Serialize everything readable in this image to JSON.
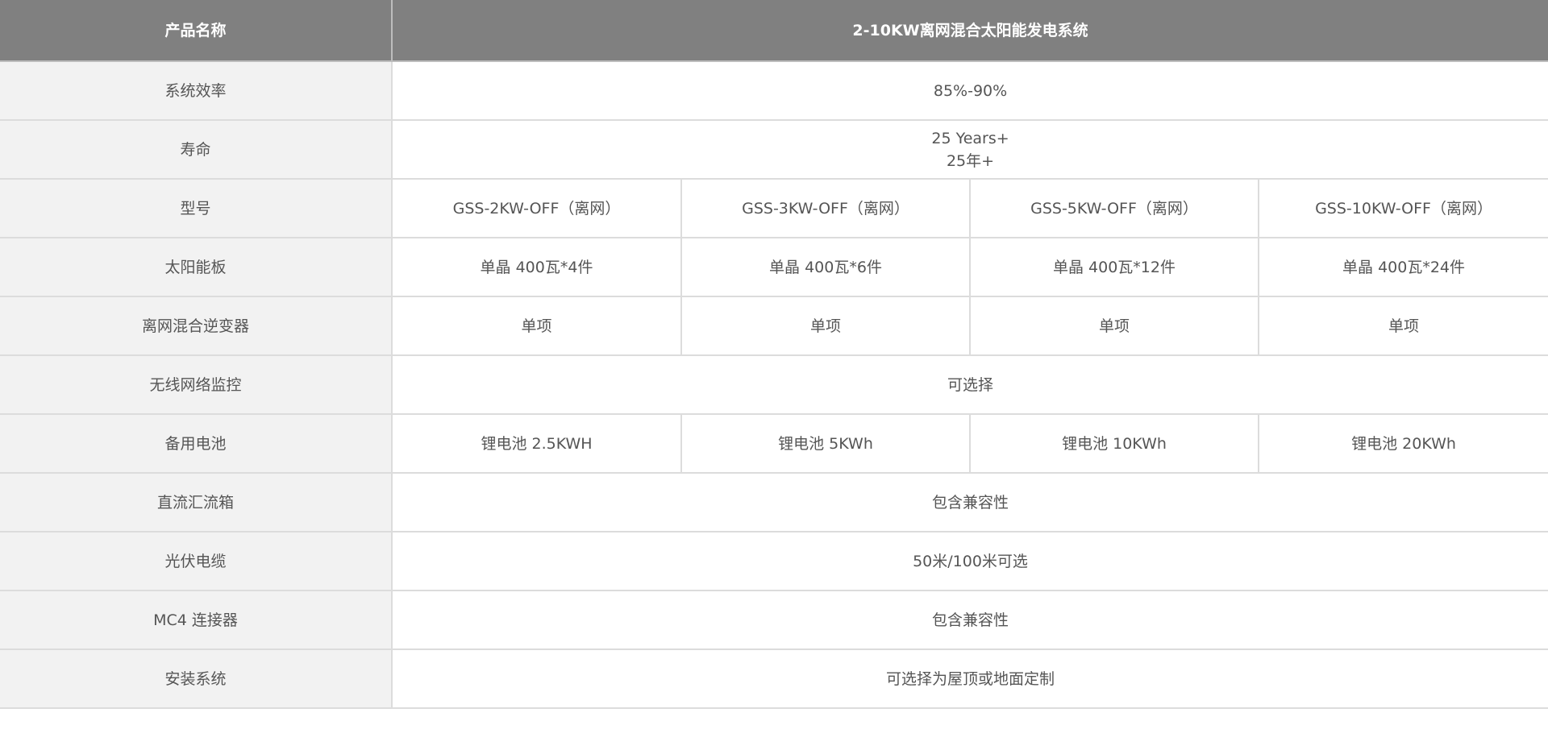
{
  "header": {
    "label": "产品名称",
    "title": "2-10KW离网混合太阳能发电系统"
  },
  "rows": {
    "efficiency": {
      "label": "系统效率",
      "value": "85%-90%"
    },
    "lifespan": {
      "label": "寿命",
      "line1": "25 Years+",
      "line2": "25年+"
    },
    "model": {
      "label": "型号",
      "values": [
        "GSS-2KW-OFF（离网）",
        "GSS-3KW-OFF（离网）",
        "GSS-5KW-OFF（离网）",
        "GSS-10KW-OFF（离网）"
      ]
    },
    "solar_panel": {
      "label": "太阳能板",
      "values": [
        "单晶 400瓦*4件",
        "单晶 400瓦*6件",
        "单晶 400瓦*12件",
        "单晶 400瓦*24件"
      ]
    },
    "inverter": {
      "label": "离网混合逆变器",
      "values": [
        "单项",
        "单项",
        "单项",
        "单项"
      ]
    },
    "wifi_monitor": {
      "label": "无线网络监控",
      "value": "可选择"
    },
    "battery": {
      "label": "备用电池",
      "values": [
        "锂电池 2.5KWH",
        "锂电池 5KWh",
        "锂电池  10KWh",
        "锂电池 20KWh"
      ]
    },
    "dc_combiner": {
      "label": "直流汇流箱",
      "value": "包含兼容性"
    },
    "pv_cable": {
      "label": "光伏电缆",
      "value": "50米/100米可选"
    },
    "mc4": {
      "label": "MC4 连接器",
      "value": "包含兼容性"
    },
    "mounting": {
      "label": "安装系统",
      "value": "可选择为屋顶或地面定制"
    }
  }
}
